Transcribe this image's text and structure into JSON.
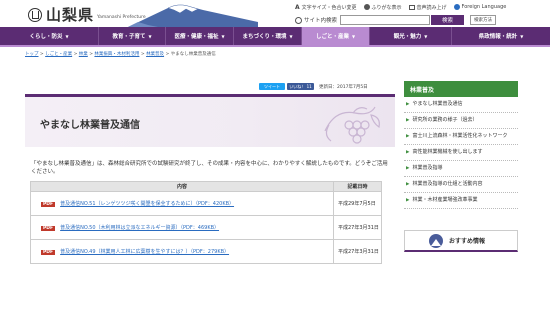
{
  "header": {
    "logo_text": "山梨県",
    "logo_sub": "Yamanashi Prefecture",
    "tools": [
      {
        "icon": "A",
        "label": "文字サイズ・色合い変更"
      },
      {
        "icon": "circle",
        "label": "ふりがな表示"
      },
      {
        "icon": "speaker",
        "label": "音声読み上げ"
      },
      {
        "icon": "globe",
        "label": "Foreign Language"
      }
    ],
    "search_label": "サイト内検索",
    "search_value": "",
    "search_button": "検索",
    "search_help": "検索方法"
  },
  "nav": {
    "items": [
      {
        "label": "くらし・防災",
        "active": false
      },
      {
        "label": "教育・子育て",
        "active": false
      },
      {
        "label": "医療・健康・福祉",
        "active": false
      },
      {
        "label": "まちづくり・環境",
        "active": false
      },
      {
        "label": "しごと・産業",
        "active": true
      },
      {
        "label": "観光・魅力",
        "active": false
      },
      {
        "label": "県政情報・統計",
        "active": false
      }
    ]
  },
  "breadcrumb": {
    "items": [
      "トップ",
      "しごと・産業",
      "林業",
      "林業振興・木材利活用",
      "林業普及"
    ],
    "current": "やまなし林業普及通信"
  },
  "social": {
    "tweet": "ツイート",
    "like": "いいね！ 11",
    "updated": "更新日：2017年7月5日"
  },
  "page": {
    "title": "やまなし林業普及通信",
    "intro": "「やまなし林業普及通信」は、森林総合研究所での試験研究が終了し、その成果・内容を中心に、わかりやすく解説したものです。どうぞご活用ください。"
  },
  "table": {
    "headers": [
      "内容",
      "記載日時"
    ],
    "rows": [
      {
        "badge": "PDF",
        "link": "普及通信NO.51（レンゲツツジ咲く開墾を保全するために）（PDF：420KB）",
        "date": "平成29年7月5日"
      },
      {
        "badge": "PDF",
        "link": "普及通信NO.50（木利用林は立派なエネルギー資源）（PDF：469KB）",
        "date": "平成27年3月31日"
      },
      {
        "badge": "PDF",
        "link": "普及通信NO.49（林業用人工林に広葉樹を生やすには？）（PDF：279KB）",
        "date": "平成27年3月31日"
      }
    ]
  },
  "sidebar": {
    "heading": "林業普及",
    "items": [
      "やまなし林業普及通信",
      "研究所の業務の様子（過去）",
      "富士川上流森林・林業活性化ネットワーク",
      "高性能林業機械を使し出します",
      "林業普及指導",
      "林業普及指導の仕組と活動内容",
      "林業・木材産業場強改革事業"
    ],
    "recommend": "おすすめ情報"
  },
  "colors": {
    "primary": "#5b2c73",
    "active_nav": "#b98bd1",
    "sidebar_head": "#3e8e3e",
    "link": "#2a6cc0",
    "pdf_badge": "#c0392b"
  }
}
